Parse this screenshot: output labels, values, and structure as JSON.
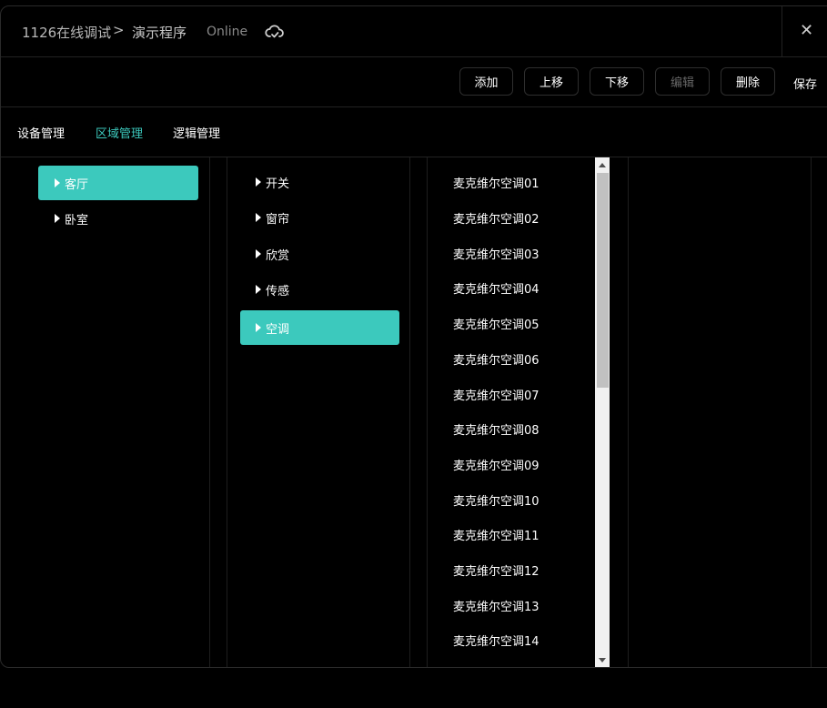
{
  "header": {
    "breadcrumb_root": "1126在线调试",
    "breadcrumb_sep": ">",
    "breadcrumb_current": "演示程序",
    "status": "Online",
    "close_symbol": "✕"
  },
  "toolbar": {
    "add": "添加",
    "move_up": "上移",
    "move_down": "下移",
    "edit": "编辑",
    "delete": "删除",
    "save": "保存"
  },
  "tabs": {
    "device": "设备管理",
    "area": "区域管理",
    "logic": "逻辑管理",
    "active": "区域管理"
  },
  "rooms": [
    {
      "label": "客厅",
      "selected": true
    },
    {
      "label": "卧室",
      "selected": false
    }
  ],
  "categories": [
    {
      "label": "开关",
      "selected": false
    },
    {
      "label": "窗帘",
      "selected": false
    },
    {
      "label": "欣赏",
      "selected": false
    },
    {
      "label": "传感",
      "selected": false
    },
    {
      "label": "空调",
      "selected": true
    }
  ],
  "devices": [
    "麦克维尔空调01",
    "麦克维尔空调02",
    "麦克维尔空调03",
    "麦克维尔空调04",
    "麦克维尔空调05",
    "麦克维尔空调06",
    "麦克维尔空调07",
    "麦克维尔空调08",
    "麦克维尔空调09",
    "麦克维尔空调10",
    "麦克维尔空调11",
    "麦克维尔空调12",
    "麦克维尔空调13",
    "麦克维尔空调14"
  ],
  "colors": {
    "accent": "#3cc9bd",
    "background": "#000000"
  }
}
